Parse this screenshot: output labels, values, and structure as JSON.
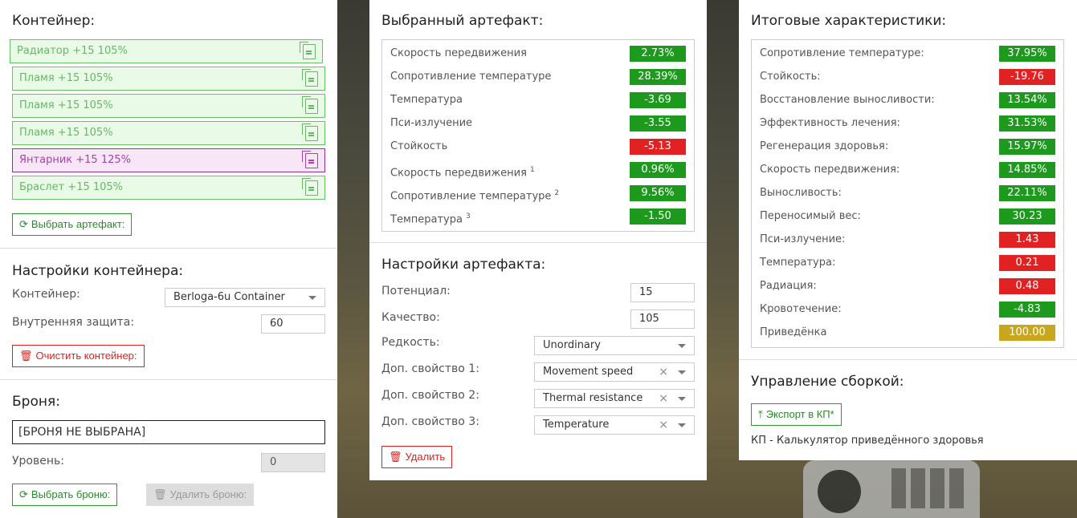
{
  "container": {
    "title": "Контейнер:",
    "slots": [
      {
        "label": "Радиатор +15 105%",
        "color": "green"
      },
      {
        "label": "Пламя +15 105%",
        "color": "green"
      },
      {
        "label": "Пламя +15 105%",
        "color": "green"
      },
      {
        "label": "Пламя +15 105%",
        "color": "green"
      },
      {
        "label": "Янтарник +15 125%",
        "color": "purple"
      },
      {
        "label": "Браслет +15 105%",
        "color": "green"
      }
    ],
    "select_artifact_btn": "Выбрать артефакт:"
  },
  "container_settings": {
    "title": "Настройки контейнера:",
    "container_label": "Контейнер:",
    "container_value": "Berloga-6u Container",
    "inner_protection_label": "Внутренняя защита:",
    "inner_protection_value": "60",
    "clear_btn": "Очистить контейнер:"
  },
  "armor": {
    "title": "Броня:",
    "armor_value": "[БРОНЯ НЕ ВЫБРАНА]",
    "level_label": "Уровень:",
    "level_value": "0",
    "select_btn": "Выбрать броню:",
    "delete_btn": "Удалить броню:"
  },
  "selected_artifact": {
    "title": "Выбранный артефакт:",
    "stats": [
      {
        "name": "Скорость передвижения",
        "sup": "",
        "value": "2.73%",
        "status": "good"
      },
      {
        "name": "Сопротивление температуре",
        "sup": "",
        "value": "28.39%",
        "status": "good"
      },
      {
        "name": "Температура",
        "sup": "",
        "value": "-3.69",
        "status": "good"
      },
      {
        "name": "Пси-излучение",
        "sup": "",
        "value": "-3.55",
        "status": "good"
      },
      {
        "name": "Стойкость",
        "sup": "",
        "value": "-5.13",
        "status": "bad"
      },
      {
        "name": "Скорость передвижения",
        "sup": "1",
        "value": "0.96%",
        "status": "good"
      },
      {
        "name": "Сопротивление температуре",
        "sup": "2",
        "value": "9.56%",
        "status": "good"
      },
      {
        "name": "Температура",
        "sup": "3",
        "value": "-1.50",
        "status": "good"
      }
    ]
  },
  "artifact_settings": {
    "title": "Настройки артефакта:",
    "potential_label": "Потенциал:",
    "potential_value": "15",
    "quality_label": "Качество:",
    "quality_value": "105",
    "rarity_label": "Редкость:",
    "rarity_value": "Unordinary",
    "extra1_label": "Доп. свойство 1:",
    "extra1_value": "Movement speed",
    "extra2_label": "Доп. свойство 2:",
    "extra2_value": "Thermal resistance",
    "extra3_label": "Доп. свойство 3:",
    "extra3_value": "Temperature",
    "clear_symbol": "×",
    "delete_btn": "Удалить"
  },
  "totals": {
    "title": "Итоговые характеристики:",
    "stats": [
      {
        "name": "Сопротивление температуре:",
        "value": "37.95%",
        "status": "good"
      },
      {
        "name": "Стойкость:",
        "value": "-19.76",
        "status": "bad"
      },
      {
        "name": "Восстановление выносливости:",
        "value": "13.54%",
        "status": "good"
      },
      {
        "name": "Эффективность лечения:",
        "value": "31.53%",
        "status": "good"
      },
      {
        "name": "Регенерация здоровья:",
        "value": "15.97%",
        "status": "good"
      },
      {
        "name": "Скорость передвижения:",
        "value": "14.85%",
        "status": "good"
      },
      {
        "name": "Выносливость:",
        "value": "22.11%",
        "status": "good"
      },
      {
        "name": "Переносимый вес:",
        "value": "30.23",
        "status": "good"
      },
      {
        "name": "Пси-излучение:",
        "value": "1.43",
        "status": "bad"
      },
      {
        "name": "Температура:",
        "value": "0.21",
        "status": "bad"
      },
      {
        "name": "Радиация:",
        "value": "0.48",
        "status": "bad"
      },
      {
        "name": "Кровотечение:",
        "value": "-4.83",
        "status": "good"
      },
      {
        "name": "Приведёнка",
        "value": "100.00",
        "status": "neutral"
      }
    ]
  },
  "build": {
    "title": "Управление сборкой:",
    "export_btn": "Экспорт в КП*",
    "footnote": "КП - Калькулятор приведённого здоровья"
  },
  "colors": {
    "good": "#1d9a1d",
    "bad": "#e22222",
    "neutral": "#c8a61d",
    "slot_green": "#66c266",
    "slot_purple": "#9b2d9b"
  }
}
